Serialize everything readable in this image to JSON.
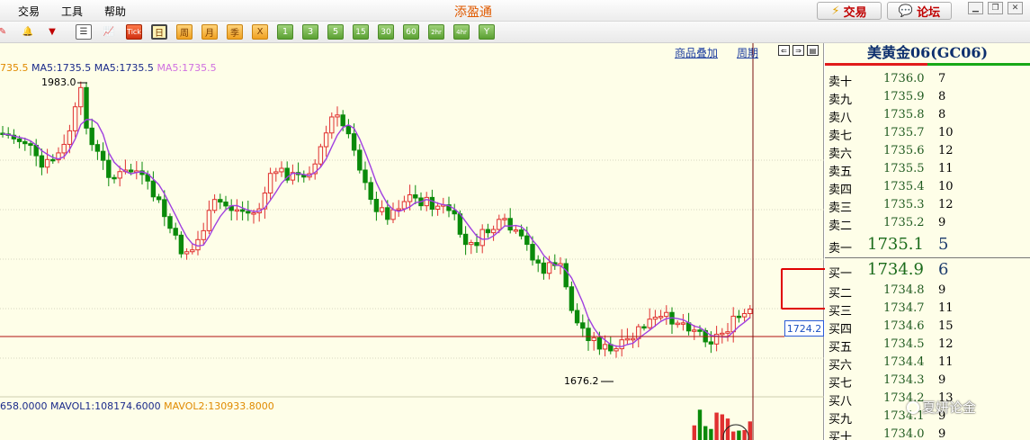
{
  "menu": {
    "trade": "交易",
    "tools": "工具",
    "help": "帮助"
  },
  "app_title": "添盈通",
  "top_buttons": {
    "trade": "交易",
    "forum": "论坛"
  },
  "toolbar": {
    "period_buttons": [
      "Tick",
      "日",
      "周",
      "月",
      "季",
      "X",
      "1",
      "3",
      "5",
      "15",
      "30",
      "60",
      "2hr",
      "4hr",
      "Y"
    ],
    "selected": "日"
  },
  "chart_header": {
    "overlay_link": "商品叠加",
    "period_link": "周期"
  },
  "ma_legend": {
    "first": "735.5",
    "ma_a": "MA5:1735.5",
    "ma_b": "MA5:1735.5",
    "ma_c": "MA5:1735.5",
    "colors": [
      "#e08a00",
      "#1a2a8a",
      "#1a2a8a",
      "#d070e0"
    ]
  },
  "vol_legend": {
    "first": "658.0000",
    "mavol1": "MAVOL1:108174.6000",
    "mavol2": "MAVOL2:130933.8000",
    "colors": [
      "#1a2a8a",
      "#1a2a8a",
      "#e08a00"
    ]
  },
  "chart_labels": {
    "high": "1983.0",
    "low": "1676.2",
    "current": "1724.2"
  },
  "colors": {
    "up": "#e03030",
    "down": "#0a8a0a",
    "ma": "#a040e0",
    "crosshair": "#b01010",
    "grid": "#d6d6c0"
  },
  "book": {
    "title": "美黄金06(GC06)",
    "asks": [
      {
        "label": "卖十",
        "price": "1736.0",
        "qty": "7"
      },
      {
        "label": "卖九",
        "price": "1735.9",
        "qty": "8"
      },
      {
        "label": "卖八",
        "price": "1735.8",
        "qty": "8"
      },
      {
        "label": "卖七",
        "price": "1735.7",
        "qty": "10"
      },
      {
        "label": "卖六",
        "price": "1735.6",
        "qty": "12"
      },
      {
        "label": "卖五",
        "price": "1735.5",
        "qty": "11"
      },
      {
        "label": "卖四",
        "price": "1735.4",
        "qty": "10"
      },
      {
        "label": "卖三",
        "price": "1735.3",
        "qty": "12"
      },
      {
        "label": "卖二",
        "price": "1735.2",
        "qty": "9"
      },
      {
        "label": "卖一",
        "price": "1735.1",
        "qty": "5"
      }
    ],
    "bids": [
      {
        "label": "买一",
        "price": "1734.9",
        "qty": "6"
      },
      {
        "label": "买二",
        "price": "1734.8",
        "qty": "9"
      },
      {
        "label": "买三",
        "price": "1734.7",
        "qty": "11"
      },
      {
        "label": "买四",
        "price": "1734.6",
        "qty": "15"
      },
      {
        "label": "买五",
        "price": "1734.5",
        "qty": "12"
      },
      {
        "label": "买六",
        "price": "1734.4",
        "qty": "11"
      },
      {
        "label": "买七",
        "price": "1734.3",
        "qty": "9"
      },
      {
        "label": "买八",
        "price": "1734.2",
        "qty": "13"
      },
      {
        "label": "买九",
        "price": "1734.1",
        "qty": "9"
      },
      {
        "label": "买十",
        "price": "1734.0",
        "qty": "9"
      }
    ]
  },
  "watermark": "夏妍论金"
}
